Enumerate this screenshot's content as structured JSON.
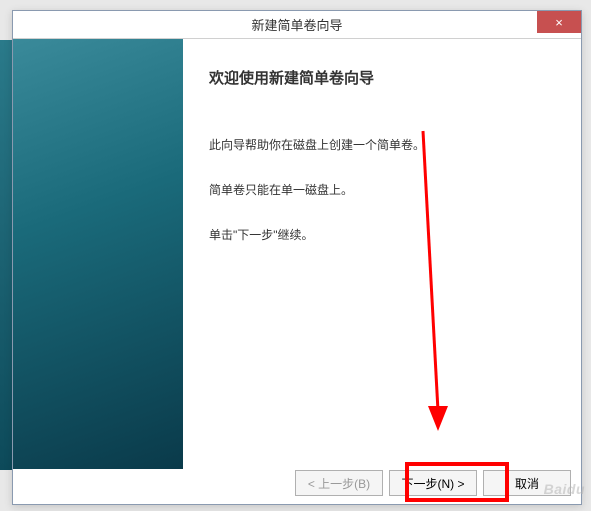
{
  "window": {
    "title": "新建简单卷向导",
    "close_icon": "×"
  },
  "content": {
    "heading": "欢迎使用新建简单卷向导",
    "line1": "此向导帮助你在磁盘上创建一个简单卷。",
    "line2": "简单卷只能在单一磁盘上。",
    "line3": "单击\"下一步\"继续。"
  },
  "buttons": {
    "back": "< 上一步(B)",
    "next": "下一步(N) >",
    "cancel": "取消"
  },
  "watermark": "Baidu"
}
